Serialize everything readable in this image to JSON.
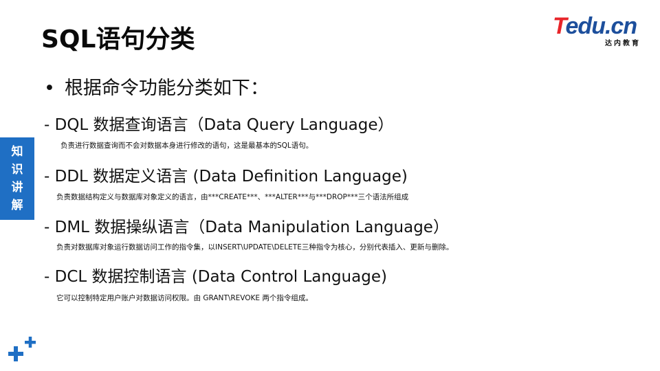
{
  "title": "SQL语句分类",
  "logo": {
    "brand_t": "T",
    "brand_rest": "edu.cn",
    "subtitle": "达内教育"
  },
  "side_tab": {
    "chars": [
      "知",
      "识",
      "讲",
      "解"
    ]
  },
  "intro": "根据命令功能分类如下：",
  "items": [
    {
      "heading": "- DQL  数据查询语言（Data Query Language）",
      "description": "负责进行数据查询而不会对数据本身进行修改的语句，这是最基本的SQL语句。"
    },
    {
      "heading": "- DDL  数据定义语言 (Data Definition Language)",
      "description": "负责数据结构定义与数据库对象定义的语言，由***CREATE***、***ALTER***与***DROP***三个语法所组成"
    },
    {
      "heading": "- DML 数据操纵语言（Data Manipulation Language）",
      "description": "负责对数据库对象运行数据访问工作的指令集，以INSERT\\UPDATE\\DELETE三种指令为核心，分别代表插入、更新与删除。"
    },
    {
      "heading": "- DCL  数据控制语言 (Data Control Language)",
      "description": "它可以控制特定用户账户对数据访问权限。由 GRANT\\REVOKE 两个指令组成。"
    }
  ],
  "colors": {
    "accent_blue": "#1f6fc4",
    "logo_red": "#e8252a",
    "logo_blue": "#1d4f9c"
  },
  "icons": {
    "corner": "plus-cross-icon"
  }
}
